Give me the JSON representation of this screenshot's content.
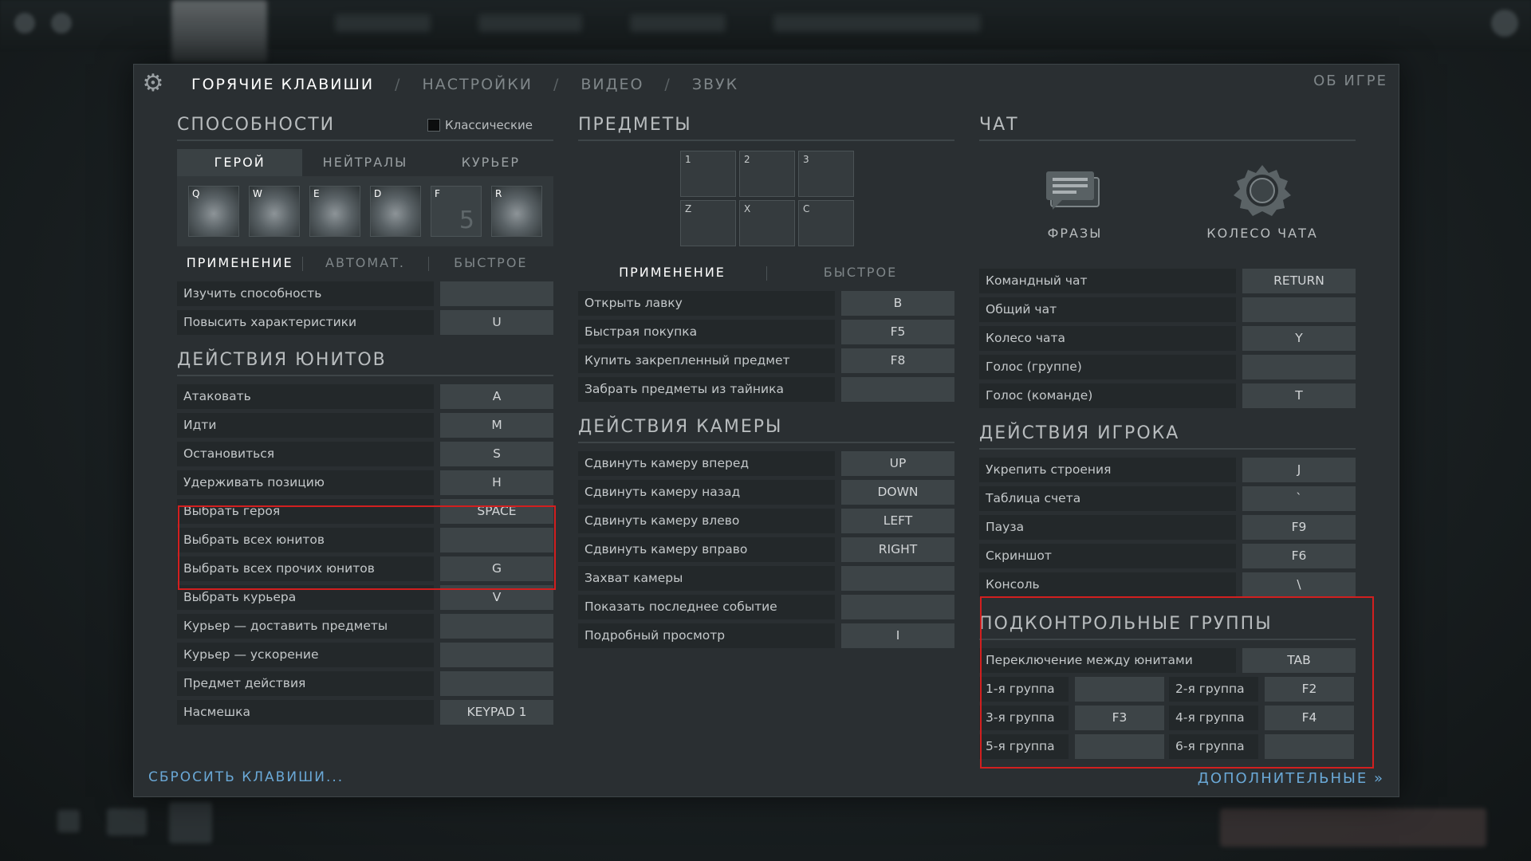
{
  "nav": {
    "tabs": [
      "ГОРЯЧИЕ КЛАВИШИ",
      "НАСТРОЙКИ",
      "ВИДЕО",
      "ЗВУК"
    ],
    "separator": "/",
    "about": "ОБ ИГРЕ"
  },
  "abilities": {
    "title": "СПОСОБНОСТИ",
    "classic_label": "Классические",
    "subtabs": [
      "ГЕРОЙ",
      "НЕЙТРАЛЫ",
      "КУРЬЕР"
    ],
    "slots": [
      {
        "key": "Q"
      },
      {
        "key": "W"
      },
      {
        "key": "E"
      },
      {
        "key": "D"
      },
      {
        "key": "F",
        "extra": "5"
      },
      {
        "key": "R"
      }
    ],
    "modes": [
      "ПРИМЕНЕНИЕ",
      "АВТОМАТ.",
      "БЫСТРОЕ"
    ],
    "rows": [
      {
        "label": "Изучить способность",
        "key": ""
      },
      {
        "label": "Повысить характеристики",
        "key": "U"
      }
    ]
  },
  "unit_actions": {
    "title": "ДЕЙСТВИЯ ЮНИТОВ",
    "rows": [
      {
        "label": "Атаковать",
        "key": "A"
      },
      {
        "label": "Идти",
        "key": "M"
      },
      {
        "label": "Остановиться",
        "key": "S"
      },
      {
        "label": "Удерживать позицию",
        "key": "H"
      },
      {
        "label": "Выбрать героя",
        "key": "SPACE"
      },
      {
        "label": "Выбрать всех юнитов",
        "key": ""
      },
      {
        "label": "Выбрать всех прочих юнитов",
        "key": "G"
      },
      {
        "label": "Выбрать курьера",
        "key": "V"
      },
      {
        "label": "Курьер — доставить предметы",
        "key": ""
      },
      {
        "label": "Курьер — ускорение",
        "key": ""
      },
      {
        "label": "Предмет действия",
        "key": ""
      },
      {
        "label": "Насмешка",
        "key": "KEYPAD 1"
      }
    ]
  },
  "items": {
    "title": "ПРЕДМЕТЫ",
    "slots": [
      "1",
      "2",
      "3",
      "Z",
      "X",
      "C"
    ],
    "modes": [
      "ПРИМЕНЕНИЕ",
      "БЫСТРОЕ"
    ],
    "rows": [
      {
        "label": "Открыть лавку",
        "key": "B"
      },
      {
        "label": "Быстрая покупка",
        "key": "F5"
      },
      {
        "label": "Купить закрепленный предмет",
        "key": "F8"
      },
      {
        "label": "Забрать предметы из тайника",
        "key": ""
      }
    ]
  },
  "camera": {
    "title": "ДЕЙСТВИЯ КАМЕРЫ",
    "rows": [
      {
        "label": "Сдвинуть камеру вперед",
        "key": "UP"
      },
      {
        "label": "Сдвинуть камеру назад",
        "key": "DOWN"
      },
      {
        "label": "Сдвинуть камеру влево",
        "key": "LEFT"
      },
      {
        "label": "Сдвинуть камеру вправо",
        "key": "RIGHT"
      },
      {
        "label": "Захват камеры",
        "key": ""
      },
      {
        "label": "Показать последнее событие",
        "key": ""
      },
      {
        "label": "Подробный просмотр",
        "key": "I"
      }
    ]
  },
  "chat": {
    "title": "ЧАТ",
    "phrases_label": "ФРАЗЫ",
    "wheel_label": "КОЛЕСО ЧАТА",
    "rows": [
      {
        "label": "Командный чат",
        "key": "RETURN"
      },
      {
        "label": "Общий чат",
        "key": ""
      },
      {
        "label": "Колесо чата",
        "key": "Y"
      },
      {
        "label": "Голос (группе)",
        "key": ""
      },
      {
        "label": "Голос (команде)",
        "key": "T"
      }
    ]
  },
  "player": {
    "title": "ДЕЙСТВИЯ ИГРОКА",
    "rows": [
      {
        "label": "Укрепить строения",
        "key": "J"
      },
      {
        "label": "Таблица счета",
        "key": "`"
      },
      {
        "label": "Пауза",
        "key": "F9"
      },
      {
        "label": "Скриншот",
        "key": "F6"
      },
      {
        "label": "Консоль",
        "key": "\\"
      }
    ]
  },
  "groups": {
    "title": "ПОДКОНТРОЛЬНЫЕ ГРУППЫ",
    "switch": {
      "label": "Переключение между юнитами",
      "key": "TAB"
    },
    "pairs": [
      [
        {
          "label": "1-я группа",
          "key": ""
        },
        {
          "label": "2-я группа",
          "key": "F2"
        }
      ],
      [
        {
          "label": "3-я группа",
          "key": "F3"
        },
        {
          "label": "4-я группа",
          "key": "F4"
        }
      ],
      [
        {
          "label": "5-я группа",
          "key": ""
        },
        {
          "label": "6-я группа",
          "key": ""
        }
      ]
    ]
  },
  "footer": {
    "reset": "СБРОСИТЬ КЛАВИШИ...",
    "more": "ДОПОЛНИТЕЛЬНЫЕ »"
  },
  "colors": {
    "highlight": "#d21f1f",
    "link": "#6aa8d6"
  }
}
